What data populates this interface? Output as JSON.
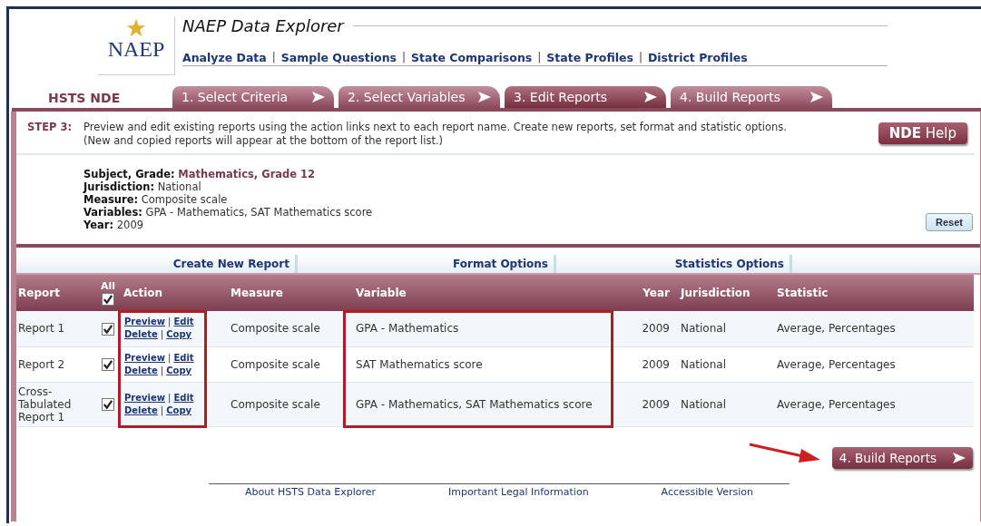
{
  "app": {
    "logo_text": "NAEP",
    "title": "NAEP Data Explorer",
    "brand": "HSTS NDE"
  },
  "nav": [
    {
      "label": "Analyze Data",
      "separator": "|"
    },
    {
      "label": "Sample Questions",
      "separator": "|"
    },
    {
      "label": "State Comparisons",
      "separator": "|"
    },
    {
      "label": "State Profiles",
      "separator": "|"
    },
    {
      "label": "District Profiles"
    }
  ],
  "steps": [
    {
      "label": "1.  Select Criteria",
      "selected": false
    },
    {
      "label": "2.  Select Variables",
      "selected": false
    },
    {
      "label": "3.  Edit Reports",
      "selected": true
    },
    {
      "label": "4.  Build Reports",
      "selected": false
    }
  ],
  "instructions": {
    "step": "STEP 3:",
    "lines": [
      "Preview and edit existing reports using the action links next to each report name. Create new reports, set format and statistic options.",
      "(New and copied reports will appear at the bottom of the report list.)"
    ],
    "help_button": "**NDE** Help"
  },
  "summary": [
    {
      "label": "Subject, Grade:",
      "value": "Mathematics, Grade 12",
      "emphasis": true
    },
    {
      "label": "Jurisdiction:",
      "value": "National",
      "emphasis": false
    },
    {
      "label": "Measure:",
      "value": "Composite scale",
      "emphasis": false
    },
    {
      "label": "Variables:",
      "value": "GPA - Mathematics, SAT Mathematics score",
      "emphasis": false
    },
    {
      "label": "Year:",
      "value": "2009",
      "emphasis": false
    }
  ],
  "reset_button": "Reset",
  "toolbar": [
    "Create New Report",
    "Format Options",
    "Statistics Options"
  ],
  "table": {
    "columns": [
      "Report",
      "All",
      "Action",
      "Measure",
      "Variable",
      "Year",
      "Jurisdiction",
      "Statistic"
    ],
    "all_checked": true,
    "rows": [
      {
        "name": "Report 1",
        "checked": true,
        "actions": [
          {
            "links": [
              "Preview",
              "Edit"
            ],
            "separator": "|"
          },
          {
            "links": [
              "Delete",
              "Copy"
            ],
            "separator": "|"
          }
        ],
        "measure": "Composite scale",
        "variable": "GPA - Mathematics",
        "year": "2009",
        "jurisdiction": "National",
        "statistic": "Average, Percentages"
      },
      {
        "name": "Report 2",
        "checked": true,
        "actions": [
          {
            "links": [
              "Preview",
              "Edit"
            ],
            "separator": "|"
          },
          {
            "links": [
              "Delete",
              "Copy"
            ],
            "separator": "|"
          }
        ],
        "measure": "Composite scale",
        "variable": "SAT Mathematics score",
        "year": "2009",
        "jurisdiction": "National",
        "statistic": "Average, Percentages"
      },
      {
        "name": "Cross-Tabulated Report 1",
        "checked": true,
        "actions": [
          {
            "links": [
              "Preview",
              "Edit"
            ],
            "separator": "|"
          },
          {
            "links": [
              "Delete",
              "Copy"
            ],
            "separator": "|"
          }
        ],
        "measure": "Composite scale",
        "variable": "GPA - Mathematics, SAT Mathematics score",
        "year": "2009",
        "jurisdiction": "National",
        "statistic": "Average, Percentages"
      }
    ]
  },
  "build_button": "4. Build Reports",
  "footer": [
    "About HSTS Data Explorer",
    "Important Legal Information",
    "Accessible Version"
  ]
}
